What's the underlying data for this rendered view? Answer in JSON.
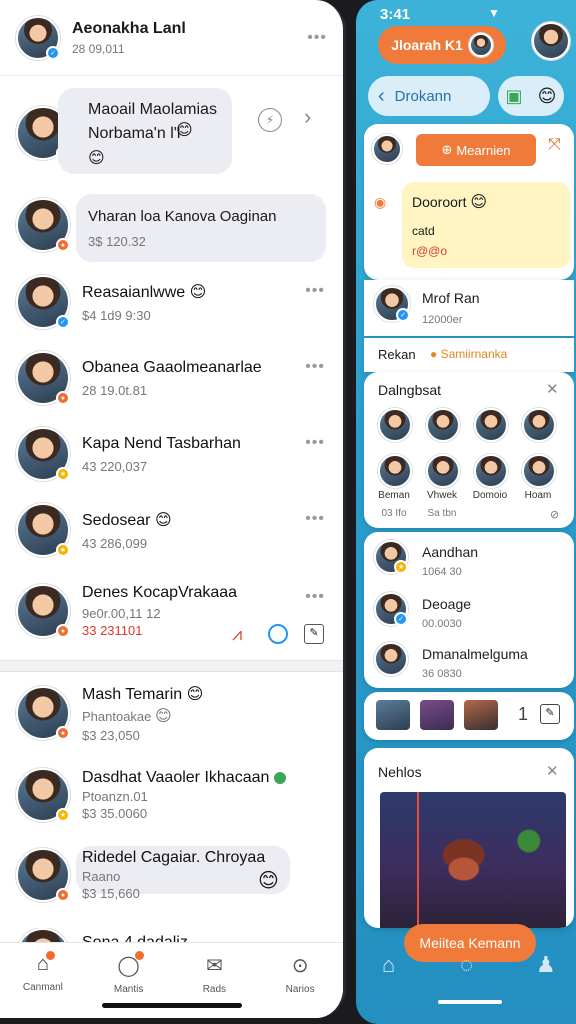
{
  "left": {
    "header": {
      "name": "Aeonakha Lanl",
      "time": "28 09,011"
    },
    "rows": [
      {
        "name": "Maoail Maolamias\nNorbama'n l'l",
        "sub": "",
        "type": "bubble"
      },
      {
        "name": "Vharan loa Kanova  Oaginan",
        "sub": "3$ 120.32",
        "type": "bubble"
      },
      {
        "name": "Reasaianlwwe",
        "sub": "$4 1d9 9:30"
      },
      {
        "name": "Obanea Gaaolmeanarlae",
        "sub": "28 19.0t.81"
      },
      {
        "name": "Kapa Nend Tasbarhan",
        "sub": "43 220,037"
      },
      {
        "name": "Sedosear",
        "sub": "43 286,099"
      },
      {
        "name": "Denes KocapVrakaaa",
        "sub": "9e0r.00,11 12",
        "sub2": "33 231101"
      },
      {
        "name": "Mash Temarin",
        "sub": "Phantoakae",
        "sub2": "$3  23,050"
      },
      {
        "name": "Dasdhat Vaaoler Ikhacaan",
        "sub": "Ptoanzn.01",
        "sub2": "$3 35.0060"
      },
      {
        "name": "Ridedel Cagaiar. Chroyaa",
        "sub": "Raano",
        "sub2": "$3 15,660"
      },
      {
        "name": "Sona 4 dadaliz",
        "sub": ""
      }
    ],
    "nav": [
      {
        "label": "Canmanl",
        "icon": "home-icon"
      },
      {
        "label": "Mantis",
        "icon": "chat-icon"
      },
      {
        "label": "Rads",
        "icon": "inbox-icon"
      },
      {
        "label": "Narios",
        "icon": "search-icon"
      }
    ]
  },
  "right": {
    "status_time": "3:41",
    "top_pill": "Jloarah  K1",
    "back_label": "Drokann",
    "tag_button": "Mearnien",
    "yellow_bubble": {
      "line1": "Dooroort",
      "line2": "catd",
      "line3": "r@@o"
    },
    "person1": {
      "name": "Mrof Ran",
      "sub": "12000er"
    },
    "row_label": "Rekan",
    "row_tag": "Samiirnanka",
    "grid_title": "Dalngbsat",
    "grid_labels": [
      "Beman",
      "Vhwek",
      "Domoio",
      "Hoam"
    ],
    "grid_sub": [
      "03 Ifo",
      "Sa tbn"
    ],
    "people": [
      {
        "name": "Aandhan",
        "sub": "1064 30"
      },
      {
        "name": "Deoage",
        "sub": "00.0030"
      },
      {
        "name": "Dmanalmelguma",
        "sub": "36 0830"
      }
    ],
    "count": "1",
    "video_title": "Nehlos",
    "bottom_button": "Meiitea Kemann"
  },
  "colors": {
    "accent": "#f07a3a",
    "blue": "#2aa0cf",
    "bubble": "#ececf3"
  }
}
